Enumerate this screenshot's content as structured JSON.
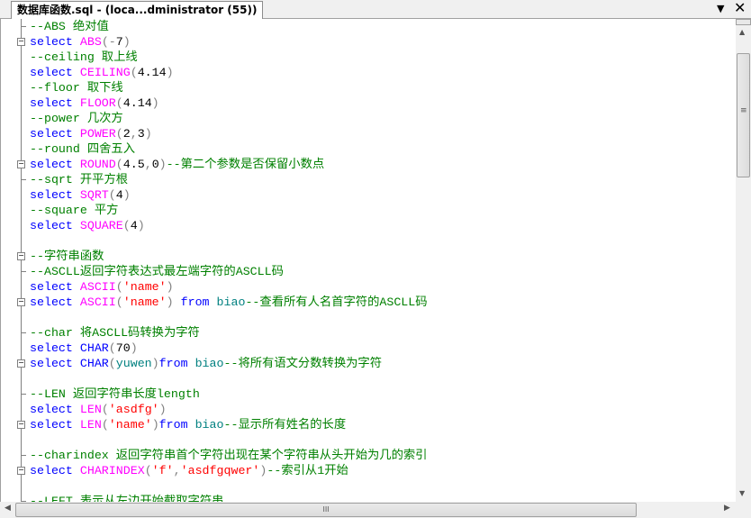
{
  "tab": {
    "title": "数据库函数.sql - (loca...dministrator (55))",
    "dropdown_icon": "▼",
    "close_icon": "✕"
  },
  "colors": {
    "keyword": "#0000ff",
    "function": "#ff00ff",
    "string": "#ff0000",
    "comment": "#008000",
    "identifier": "#008080",
    "operator": "#808080"
  },
  "editor": {
    "lines": [
      {
        "fold": "end",
        "tokens": [
          [
            "cm",
            "--ABS 绝对值"
          ]
        ]
      },
      {
        "fold": "start",
        "tokens": [
          [
            "kw",
            "select "
          ],
          [
            "fn",
            "ABS"
          ],
          [
            "op",
            "(-"
          ],
          [
            "tx",
            "7"
          ],
          [
            "op",
            ")"
          ]
        ]
      },
      {
        "tokens": [
          [
            "cm",
            "--ceiling 取上线"
          ]
        ]
      },
      {
        "tokens": [
          [
            "kw",
            "select "
          ],
          [
            "fn",
            "CEILING"
          ],
          [
            "op",
            "("
          ],
          [
            "tx",
            "4.14"
          ],
          [
            "op",
            ")"
          ]
        ]
      },
      {
        "tokens": [
          [
            "cm",
            "--floor 取下线"
          ]
        ]
      },
      {
        "tokens": [
          [
            "kw",
            "select "
          ],
          [
            "fn",
            "FLOOR"
          ],
          [
            "op",
            "("
          ],
          [
            "tx",
            "4.14"
          ],
          [
            "op",
            ")"
          ]
        ]
      },
      {
        "tokens": [
          [
            "cm",
            "--power 几次方"
          ]
        ]
      },
      {
        "tokens": [
          [
            "kw",
            "select "
          ],
          [
            "fn",
            "POWER"
          ],
          [
            "op",
            "("
          ],
          [
            "tx",
            "2"
          ],
          [
            "op",
            ","
          ],
          [
            "tx",
            "3"
          ],
          [
            "op",
            ")"
          ]
        ]
      },
      {
        "tokens": [
          [
            "cm",
            "--round 四舍五入"
          ]
        ]
      },
      {
        "fold": "start",
        "tokens": [
          [
            "kw",
            "select "
          ],
          [
            "fn",
            "ROUND"
          ],
          [
            "op",
            "("
          ],
          [
            "tx",
            "4.5"
          ],
          [
            "op",
            ","
          ],
          [
            "tx",
            "0"
          ],
          [
            "op",
            ")"
          ],
          [
            "cm",
            "--第二个参数是否保留小数点"
          ]
        ]
      },
      {
        "fold": "tick",
        "tokens": [
          [
            "cm",
            "--sqrt 开平方根"
          ]
        ]
      },
      {
        "tokens": [
          [
            "kw",
            "select "
          ],
          [
            "fn",
            "SQRT"
          ],
          [
            "op",
            "("
          ],
          [
            "tx",
            "4"
          ],
          [
            "op",
            ")"
          ]
        ]
      },
      {
        "tokens": [
          [
            "cm",
            "--square 平方"
          ]
        ]
      },
      {
        "tokens": [
          [
            "kw",
            "select "
          ],
          [
            "fn",
            "SQUARE"
          ],
          [
            "op",
            "("
          ],
          [
            "tx",
            "4"
          ],
          [
            "op",
            ")"
          ]
        ]
      },
      {
        "tokens": []
      },
      {
        "fold": "start",
        "tokens": [
          [
            "cm",
            "--字符串函数"
          ]
        ]
      },
      {
        "fold": "tick",
        "tokens": [
          [
            "cm",
            "--ASCLL返回字符表达式最左端字符的ASCLL码"
          ]
        ]
      },
      {
        "tokens": [
          [
            "kw",
            "select "
          ],
          [
            "fn",
            "ASCII"
          ],
          [
            "op",
            "("
          ],
          [
            "str",
            "'name'"
          ],
          [
            "op",
            ")"
          ]
        ]
      },
      {
        "fold": "start",
        "tokens": [
          [
            "kw",
            "select "
          ],
          [
            "fn",
            "ASCII"
          ],
          [
            "op",
            "("
          ],
          [
            "str",
            "'name'"
          ],
          [
            "op",
            ") "
          ],
          [
            "kw",
            "from "
          ],
          [
            "id",
            "biao"
          ],
          [
            "cm",
            "--查看所有人名首字符的ASCLL码"
          ]
        ]
      },
      {
        "tokens": []
      },
      {
        "fold": "tick",
        "tokens": [
          [
            "cm",
            "--char 将ASCLL码转换为字符"
          ]
        ]
      },
      {
        "tokens": [
          [
            "kw",
            "select "
          ],
          [
            "kw",
            "CHAR"
          ],
          [
            "op",
            "("
          ],
          [
            "tx",
            "70"
          ],
          [
            "op",
            ")"
          ]
        ]
      },
      {
        "fold": "start",
        "tokens": [
          [
            "kw",
            "select "
          ],
          [
            "kw",
            "CHAR"
          ],
          [
            "op",
            "("
          ],
          [
            "id",
            "yuwen"
          ],
          [
            "op",
            ")"
          ],
          [
            "kw",
            "from "
          ],
          [
            "id",
            "biao"
          ],
          [
            "cm",
            "--将所有语文分数转换为字符"
          ]
        ]
      },
      {
        "tokens": []
      },
      {
        "fold": "tick",
        "tokens": [
          [
            "cm",
            "--LEN 返回字符串长度length"
          ]
        ]
      },
      {
        "tokens": [
          [
            "kw",
            "select "
          ],
          [
            "fn",
            "LEN"
          ],
          [
            "op",
            "("
          ],
          [
            "str",
            "'asdfg'"
          ],
          [
            "op",
            ")"
          ]
        ]
      },
      {
        "fold": "start",
        "tokens": [
          [
            "kw",
            "select "
          ],
          [
            "fn",
            "LEN"
          ],
          [
            "op",
            "("
          ],
          [
            "str",
            "'name'"
          ],
          [
            "op",
            ")"
          ],
          [
            "kw",
            "from "
          ],
          [
            "id",
            "biao"
          ],
          [
            "cm",
            "--显示所有姓名的长度"
          ]
        ]
      },
      {
        "tokens": []
      },
      {
        "fold": "tick",
        "tokens": [
          [
            "cm",
            "--charindex 返回字符串首个字符出现在某个字符串从头开始为几的索引"
          ]
        ]
      },
      {
        "fold": "start",
        "tokens": [
          [
            "kw",
            "select "
          ],
          [
            "fn",
            "CHARINDEX"
          ],
          [
            "op",
            "("
          ],
          [
            "str",
            "'f'"
          ],
          [
            "op",
            ","
          ],
          [
            "str",
            "'asdfgqwer'"
          ],
          [
            "op",
            ")"
          ],
          [
            "cm",
            "--索引从1开始"
          ]
        ]
      },
      {
        "tokens": []
      },
      {
        "fold": "tick",
        "tokens": [
          [
            "cm",
            "--LEFT 表示从左边开始截取字符串"
          ]
        ]
      }
    ]
  },
  "scrollbars": {
    "vertical_position": 0.0,
    "horizontal_position": 0.0,
    "grip": "≡",
    "hgrip": "III"
  }
}
